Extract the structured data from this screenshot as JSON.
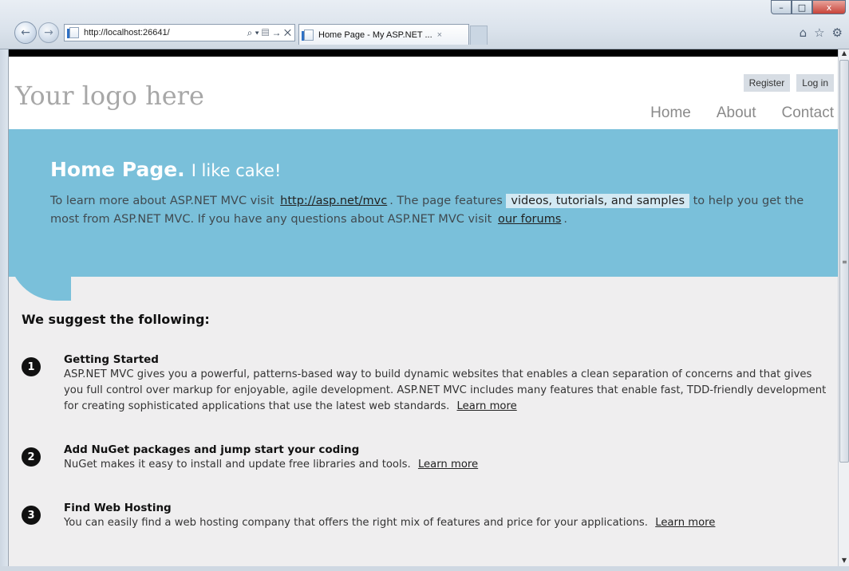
{
  "browser": {
    "url": "http://localhost:26641/",
    "tab_title": "Home Page - My ASP.NET ...",
    "tab_close": "×",
    "addr_tools": "⌕ ▾ ▤ → ✕",
    "win_min": "–",
    "win_max": "□",
    "win_close": "x",
    "icons": [
      "home-icon",
      "star-icon",
      "gear-icon"
    ]
  },
  "header": {
    "logo": "Your logo here",
    "register": "Register",
    "login": "Log in",
    "menu": [
      "Home",
      "About",
      "Contact"
    ]
  },
  "hero": {
    "title": "Home Page.",
    "subtitle": "I like cake!",
    "text_1": "To learn more about ASP.NET MVC visit",
    "link_mvc": "http://asp.net/mvc",
    "text_2": ". The page features",
    "highlight": "videos, tutorials, and samples",
    "text_3": "to help you get the most from ASP.NET MVC. If you have any questions about ASP.NET MVC visit",
    "link_forums": "our forums",
    "text_4": "."
  },
  "main": {
    "heading": "We suggest the following:",
    "steps": [
      {
        "num": "1",
        "title": "Getting Started",
        "text": "ASP.NET MVC gives you a powerful, patterns-based way to build dynamic websites that enables a clean separation of concerns and that gives you full control over markup for enjoyable, agile development. ASP.NET MVC includes many features that enable fast, TDD-friendly development for creating sophisticated applications that use the latest web standards.",
        "link": "Learn more"
      },
      {
        "num": "2",
        "title": "Add NuGet packages and jump start your coding",
        "text": "NuGet makes it easy to install and update free libraries and tools.",
        "link": "Learn more"
      },
      {
        "num": "3",
        "title": "Find Web Hosting",
        "text": "You can easily find a web hosting company that offers the right mix of features and price for your applications.",
        "link": "Learn more"
      }
    ]
  },
  "colors": {
    "hero_bg": "#7ac0da",
    "page_bg": "#efeeef",
    "highlight_bg": "#d3e9f3"
  }
}
